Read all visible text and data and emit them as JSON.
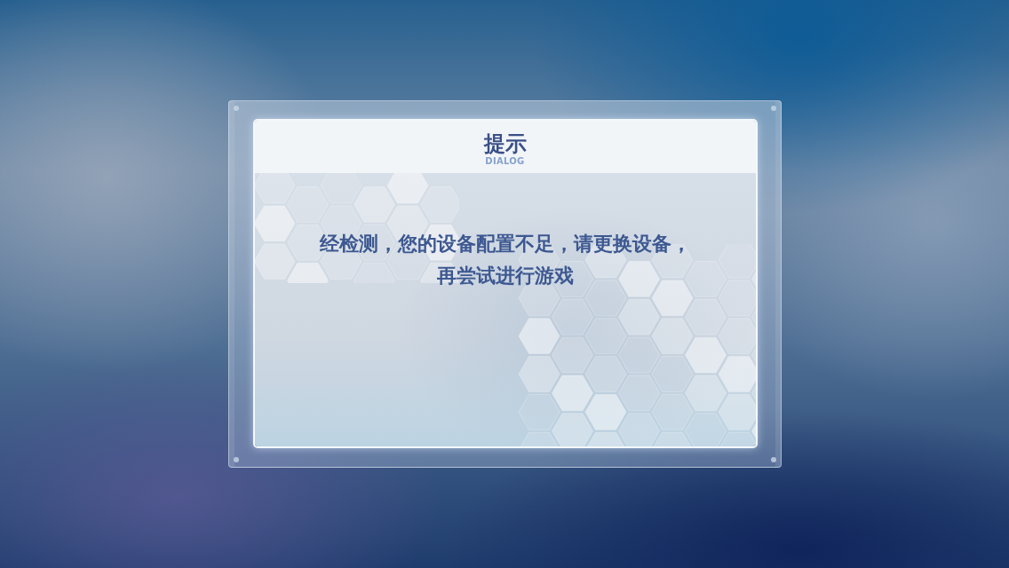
{
  "dialog": {
    "title": "提示",
    "subtitle": "DIALOG",
    "message": "经检测，您的设备配置不足，请更换设备，再尝试进行游戏"
  }
}
